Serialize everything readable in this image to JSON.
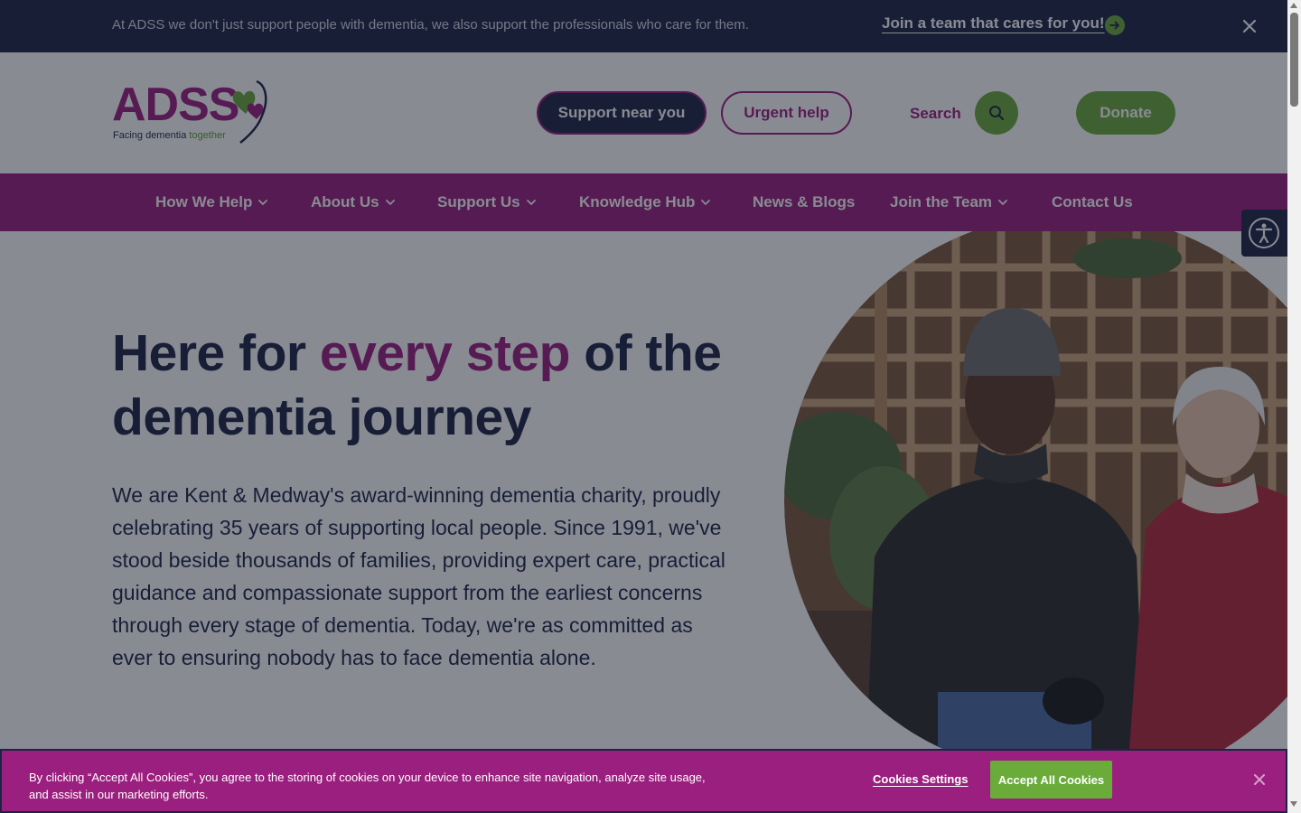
{
  "topbar": {
    "message": "At ADSS we don't just support people with dementia, we also support the professionals who care for them.",
    "link_label": "Join a team that cares for you!",
    "arrow_icon": "arrow-right-icon",
    "close_icon": "close-icon"
  },
  "header": {
    "logo_text": "ADSS",
    "logo_tagline_part1": "Facing dementia ",
    "logo_tagline_part2": "together",
    "support_button": "Support near you",
    "urgent_button": "Urgent help",
    "search_label": "Search",
    "donate_button": "Donate"
  },
  "nav": {
    "items": [
      {
        "label": "How We Help",
        "has_dropdown": true
      },
      {
        "label": "About Us",
        "has_dropdown": true
      },
      {
        "label": "Support Us",
        "has_dropdown": true
      },
      {
        "label": "Knowledge Hub",
        "has_dropdown": true
      },
      {
        "label": "News & Blogs",
        "has_dropdown": false
      },
      {
        "label": "Join the Team",
        "has_dropdown": true
      },
      {
        "label": "Contact Us",
        "has_dropdown": false
      }
    ]
  },
  "hero": {
    "title_part1": "Here for ",
    "title_highlight": "every step",
    "title_part2": " of the dementia journey",
    "body": "We are Kent & Medway's award-winning dementia charity, proudly celebrating 35 years of supporting local people. Since 1991, we've stood beside thousands of families, providing expert care, practical guidance and compassionate support from the earliest concerns through every stage of dementia. Today, we're as committed as ever to ensuring nobody has to face dementia alone."
  },
  "cookie": {
    "text": "By clicking “Accept All Cookies”, you agree to the storing of cookies on your device to enhance site navigation, analyze site usage, and assist in our marketing efforts.",
    "settings_label": "Cookies Settings",
    "accept_label": "Accept All Cookies"
  },
  "colors": {
    "navy": "#1b2445",
    "magenta": "#9b1f7e",
    "green": "#6aab3a"
  }
}
